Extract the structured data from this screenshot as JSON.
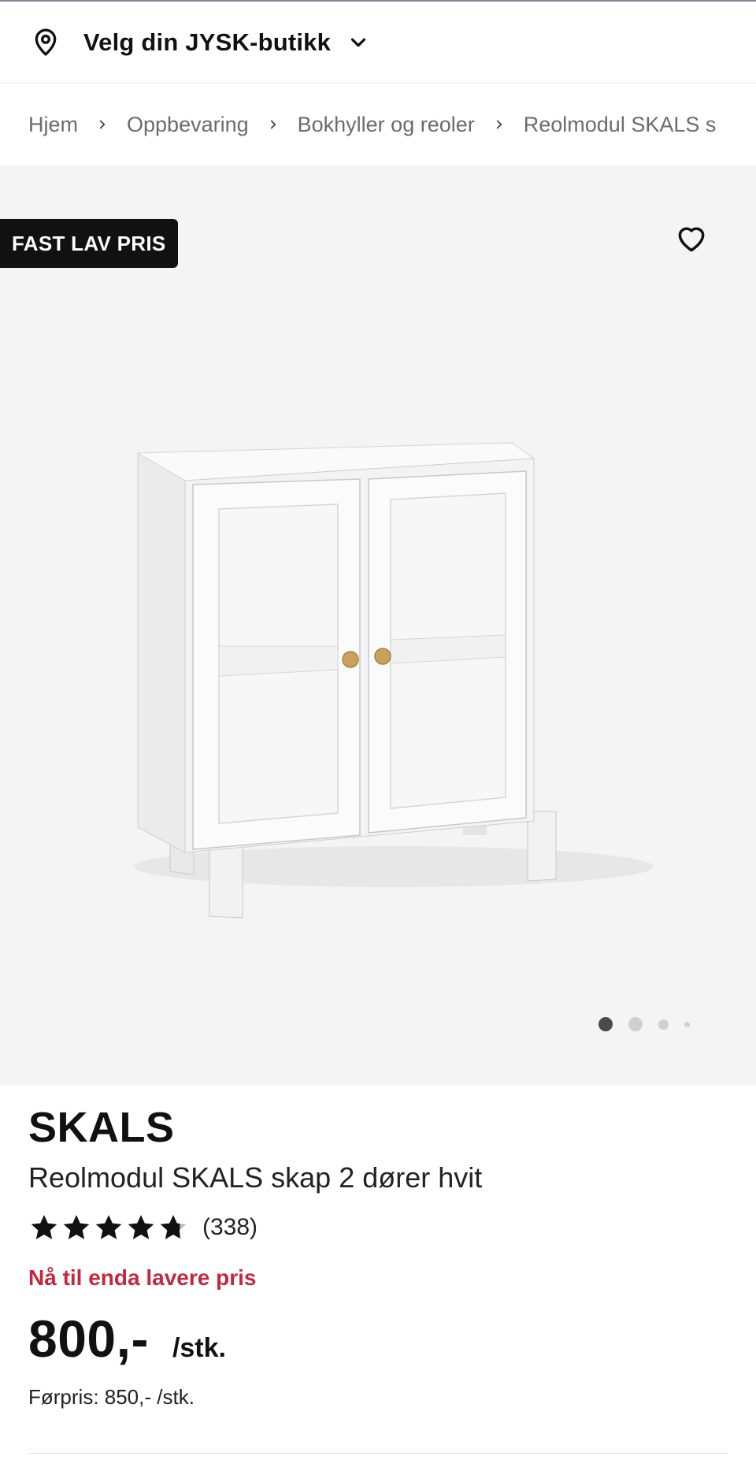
{
  "header": {
    "store_label": "Velg din JYSK-butikk",
    "pin_icon": "location-pin-icon",
    "chevron_icon": "chevron-down-icon"
  },
  "breadcrumb": {
    "items": [
      "Hjem",
      "Oppbevaring",
      "Bokhyller og reoler",
      "Reolmodul SKALS s"
    ]
  },
  "gallery": {
    "badge": "FAST LAV PRIS",
    "favorite_icon": "heart-outline-icon",
    "image_count": 4,
    "active_image": 1
  },
  "product": {
    "brand": "SKALS",
    "name": "Reolmodul SKALS skap 2 dører hvit",
    "rating": 4.7,
    "rating_count": "(338)",
    "promo_text": "Nå til enda lavere pris",
    "price": "800,-",
    "unit": "/stk.",
    "before_price": "Førpris: 850,- /stk."
  },
  "colors": {
    "promo": "#c4283c",
    "badge_bg": "#111111",
    "gallery_bg": "#f4f4f4",
    "text": "#111111"
  }
}
